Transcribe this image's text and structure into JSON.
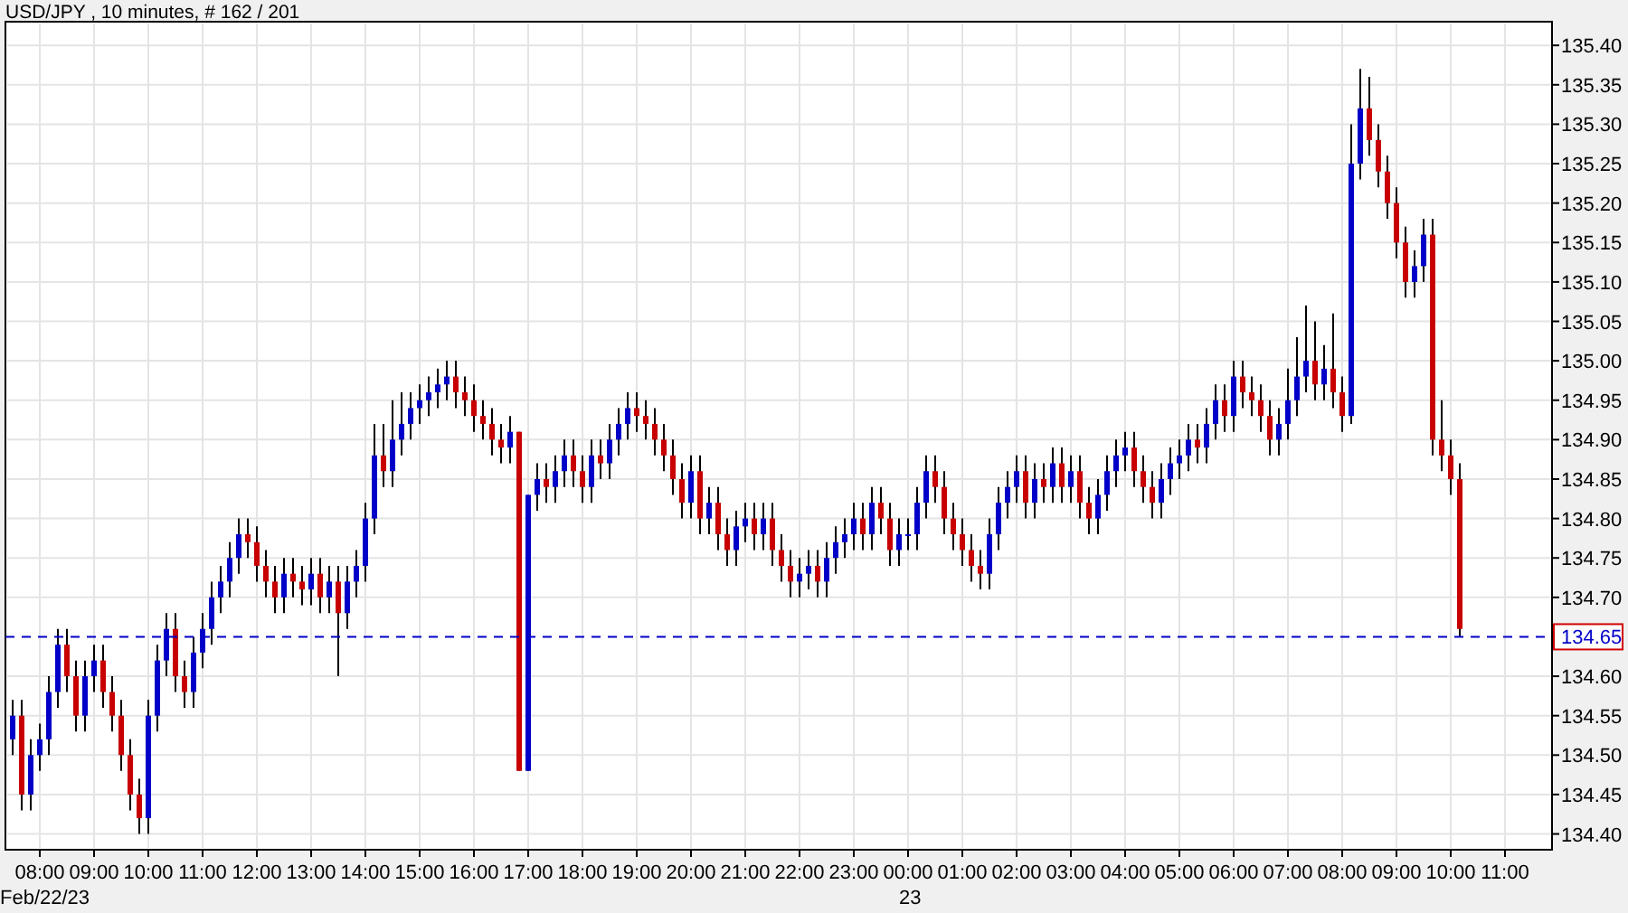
{
  "title": "USD/JPY , 10 minutes, # 162 / 201",
  "date_labels": [
    "Feb/22/23",
    "23"
  ],
  "chart_data": {
    "type": "candlestick",
    "ylim": [
      134.38,
      135.43
    ],
    "grid": true,
    "ref_lines": [
      {
        "axis": "y",
        "value": 134.65,
        "label": "134.65",
        "color": "#0000c8"
      }
    ],
    "yticks": [
      {
        "value": 134.4,
        "label": "134.40"
      },
      {
        "value": 134.45,
        "label": "134.45"
      },
      {
        "value": 134.5,
        "label": "134.50"
      },
      {
        "value": 134.55,
        "label": "134.55"
      },
      {
        "value": 134.6,
        "label": "134.60"
      },
      {
        "value": 134.7,
        "label": "134.70"
      },
      {
        "value": 134.75,
        "label": "134.75"
      },
      {
        "value": 134.8,
        "label": "134.80"
      },
      {
        "value": 134.85,
        "label": "134.85"
      },
      {
        "value": 134.9,
        "label": "134.90"
      },
      {
        "value": 134.95,
        "label": "134.95"
      },
      {
        "value": 135.0,
        "label": "135.00"
      },
      {
        "value": 135.05,
        "label": "135.05"
      },
      {
        "value": 135.1,
        "label": "135.10"
      },
      {
        "value": 135.15,
        "label": "135.15"
      },
      {
        "value": 135.2,
        "label": "135.20"
      },
      {
        "value": 135.25,
        "label": "135.25"
      },
      {
        "value": 135.3,
        "label": "135.30"
      },
      {
        "value": 135.35,
        "label": "135.35"
      },
      {
        "value": 135.4,
        "label": "135.40"
      }
    ],
    "categories": [
      null,
      null,
      null,
      "08:00",
      null,
      null,
      null,
      null,
      null,
      "09:00",
      null,
      null,
      null,
      null,
      null,
      "10:00",
      null,
      null,
      null,
      null,
      null,
      "11:00",
      null,
      null,
      null,
      null,
      null,
      "12:00",
      null,
      null,
      null,
      null,
      null,
      "13:00",
      null,
      null,
      null,
      null,
      null,
      "14:00",
      null,
      null,
      null,
      null,
      null,
      "15:00",
      null,
      null,
      null,
      null,
      null,
      "16:00",
      null,
      null,
      null,
      null,
      null,
      "17:00",
      null,
      null,
      null,
      null,
      null,
      "18:00",
      null,
      null,
      null,
      null,
      null,
      "19:00",
      null,
      null,
      null,
      null,
      null,
      "20:00",
      null,
      null,
      null,
      null,
      null,
      "21:00",
      null,
      null,
      null,
      null,
      null,
      "22:00",
      null,
      null,
      null,
      null,
      null,
      "23:00",
      null,
      null,
      null,
      null,
      null,
      "00:00",
      null,
      null,
      null,
      null,
      null,
      "01:00",
      null,
      null,
      null,
      null,
      null,
      "02:00",
      null,
      null,
      null,
      null,
      null,
      "03:00",
      null,
      null,
      null,
      null,
      null,
      "04:00",
      null,
      null,
      null,
      null,
      null,
      "05:00",
      null,
      null,
      null,
      null,
      null,
      "06:00",
      null,
      null,
      null,
      null,
      null,
      "07:00",
      null,
      null,
      null,
      null,
      null,
      "08:00",
      null,
      null,
      null,
      null,
      null,
      "09:00",
      null,
      null,
      null,
      null,
      null,
      "10:00",
      null,
      null,
      null,
      null,
      null,
      "11:00"
    ],
    "ohlc": [
      [
        134.52,
        134.57,
        134.5,
        134.55
      ],
      [
        134.55,
        134.57,
        134.43,
        134.45
      ],
      [
        134.45,
        134.52,
        134.43,
        134.5
      ],
      [
        134.5,
        134.54,
        134.48,
        134.52
      ],
      [
        134.52,
        134.6,
        134.5,
        134.58
      ],
      [
        134.58,
        134.66,
        134.56,
        134.64
      ],
      [
        134.64,
        134.66,
        134.58,
        134.6
      ],
      [
        134.6,
        134.62,
        134.53,
        134.55
      ],
      [
        134.55,
        134.62,
        134.53,
        134.6
      ],
      [
        134.6,
        134.64,
        134.58,
        134.62
      ],
      [
        134.62,
        134.64,
        134.56,
        134.58
      ],
      [
        134.58,
        134.6,
        134.53,
        134.55
      ],
      [
        134.55,
        134.57,
        134.48,
        134.5
      ],
      [
        134.5,
        134.52,
        134.43,
        134.45
      ],
      [
        134.45,
        134.47,
        134.4,
        134.42
      ],
      [
        134.42,
        134.57,
        134.4,
        134.55
      ],
      [
        134.55,
        134.64,
        134.53,
        134.62
      ],
      [
        134.62,
        134.68,
        134.6,
        134.66
      ],
      [
        134.66,
        134.68,
        134.58,
        134.6
      ],
      [
        134.6,
        134.62,
        134.56,
        134.58
      ],
      [
        134.58,
        134.65,
        134.56,
        134.63
      ],
      [
        134.63,
        134.68,
        134.61,
        134.66
      ],
      [
        134.66,
        134.72,
        134.64,
        134.7
      ],
      [
        134.7,
        134.74,
        134.68,
        134.72
      ],
      [
        134.72,
        134.77,
        134.7,
        134.75
      ],
      [
        134.75,
        134.8,
        134.73,
        134.78
      ],
      [
        134.78,
        134.8,
        134.75,
        134.77
      ],
      [
        134.77,
        134.79,
        134.72,
        134.74
      ],
      [
        134.74,
        134.76,
        134.7,
        134.72
      ],
      [
        134.72,
        134.74,
        134.68,
        134.7
      ],
      [
        134.7,
        134.75,
        134.68,
        134.73
      ],
      [
        134.73,
        134.75,
        134.7,
        134.72
      ],
      [
        134.72,
        134.74,
        134.69,
        134.71
      ],
      [
        134.71,
        134.75,
        134.69,
        134.73
      ],
      [
        134.73,
        134.75,
        134.68,
        134.7
      ],
      [
        134.7,
        134.74,
        134.68,
        134.72
      ],
      [
        134.72,
        134.74,
        134.6,
        134.68
      ],
      [
        134.68,
        134.74,
        134.66,
        134.72
      ],
      [
        134.72,
        134.76,
        134.7,
        134.74
      ],
      [
        134.74,
        134.82,
        134.72,
        134.8
      ],
      [
        134.8,
        134.92,
        134.78,
        134.88
      ],
      [
        134.88,
        134.92,
        134.84,
        134.86
      ],
      [
        134.86,
        134.95,
        134.84,
        134.9
      ],
      [
        134.9,
        134.96,
        134.88,
        134.92
      ],
      [
        134.92,
        134.96,
        134.9,
        134.94
      ],
      [
        134.94,
        134.97,
        134.92,
        134.95
      ],
      [
        134.95,
        134.98,
        134.93,
        134.96
      ],
      [
        134.96,
        134.99,
        134.94,
        134.97
      ],
      [
        134.97,
        135.0,
        134.95,
        134.98
      ],
      [
        134.98,
        135.0,
        134.94,
        134.96
      ],
      [
        134.96,
        134.98,
        134.93,
        134.95
      ],
      [
        134.95,
        134.97,
        134.91,
        134.93
      ],
      [
        134.93,
        134.95,
        134.9,
        134.92
      ],
      [
        134.92,
        134.94,
        134.88,
        134.9
      ],
      [
        134.9,
        134.92,
        134.87,
        134.89
      ],
      [
        134.89,
        134.93,
        134.87,
        134.91
      ],
      [
        134.91,
        134.91,
        134.48,
        134.48
      ],
      [
        134.48,
        134.83,
        134.48,
        134.83
      ],
      [
        134.83,
        134.87,
        134.81,
        134.85
      ],
      [
        134.85,
        134.87,
        134.82,
        134.84
      ],
      [
        134.84,
        134.88,
        134.82,
        134.86
      ],
      [
        134.86,
        134.9,
        134.84,
        134.88
      ],
      [
        134.88,
        134.9,
        134.84,
        134.86
      ],
      [
        134.86,
        134.88,
        134.82,
        134.84
      ],
      [
        134.84,
        134.9,
        134.82,
        134.88
      ],
      [
        134.88,
        134.9,
        134.85,
        134.87
      ],
      [
        134.87,
        134.92,
        134.85,
        134.9
      ],
      [
        134.9,
        134.94,
        134.88,
        134.92
      ],
      [
        134.92,
        134.96,
        134.9,
        134.94
      ],
      [
        134.94,
        134.96,
        134.91,
        134.93
      ],
      [
        134.93,
        134.95,
        134.9,
        134.92
      ],
      [
        134.92,
        134.94,
        134.88,
        134.9
      ],
      [
        134.9,
        134.92,
        134.86,
        134.88
      ],
      [
        134.88,
        134.9,
        134.83,
        134.85
      ],
      [
        134.85,
        134.87,
        134.8,
        134.82
      ],
      [
        134.82,
        134.88,
        134.8,
        134.86
      ],
      [
        134.86,
        134.88,
        134.78,
        134.8
      ],
      [
        134.8,
        134.84,
        134.78,
        134.82
      ],
      [
        134.82,
        134.84,
        134.76,
        134.78
      ],
      [
        134.78,
        134.8,
        134.74,
        134.76
      ],
      [
        134.76,
        134.81,
        134.74,
        134.79
      ],
      [
        134.79,
        134.82,
        134.77,
        134.8
      ],
      [
        134.8,
        134.82,
        134.76,
        134.78
      ],
      [
        134.78,
        134.82,
        134.76,
        134.8
      ],
      [
        134.8,
        134.82,
        134.74,
        134.76
      ],
      [
        134.76,
        134.78,
        134.72,
        134.74
      ],
      [
        134.74,
        134.76,
        134.7,
        134.72
      ],
      [
        134.72,
        134.75,
        134.7,
        134.73
      ],
      [
        134.73,
        134.76,
        134.71,
        134.74
      ],
      [
        134.74,
        134.76,
        134.7,
        134.72
      ],
      [
        134.72,
        134.77,
        134.7,
        134.75
      ],
      [
        134.75,
        134.79,
        134.73,
        134.77
      ],
      [
        134.77,
        134.8,
        134.75,
        134.78
      ],
      [
        134.78,
        134.82,
        134.76,
        134.8
      ],
      [
        134.8,
        134.82,
        134.76,
        134.78
      ],
      [
        134.78,
        134.84,
        134.76,
        134.82
      ],
      [
        134.82,
        134.84,
        134.78,
        134.8
      ],
      [
        134.8,
        134.82,
        134.74,
        134.76
      ],
      [
        134.76,
        134.8,
        134.74,
        134.78
      ],
      [
        134.78,
        134.8,
        134.76,
        134.78
      ],
      [
        134.78,
        134.84,
        134.76,
        134.82
      ],
      [
        134.82,
        134.88,
        134.8,
        134.86
      ],
      [
        134.86,
        134.88,
        134.82,
        134.84
      ],
      [
        134.84,
        134.86,
        134.78,
        134.8
      ],
      [
        134.8,
        134.82,
        134.76,
        134.78
      ],
      [
        134.78,
        134.8,
        134.74,
        134.76
      ],
      [
        134.76,
        134.78,
        134.72,
        134.74
      ],
      [
        134.74,
        134.76,
        134.71,
        134.73
      ],
      [
        134.73,
        134.8,
        134.71,
        134.78
      ],
      [
        134.78,
        134.84,
        134.76,
        134.82
      ],
      [
        134.82,
        134.86,
        134.8,
        134.84
      ],
      [
        134.84,
        134.88,
        134.82,
        134.86
      ],
      [
        134.86,
        134.88,
        134.8,
        134.82
      ],
      [
        134.82,
        134.87,
        134.8,
        134.85
      ],
      [
        134.85,
        134.87,
        134.82,
        134.84
      ],
      [
        134.84,
        134.89,
        134.82,
        134.87
      ],
      [
        134.87,
        134.89,
        134.82,
        134.84
      ],
      [
        134.84,
        134.88,
        134.82,
        134.86
      ],
      [
        134.86,
        134.88,
        134.8,
        134.82
      ],
      [
        134.82,
        134.84,
        134.78,
        134.8
      ],
      [
        134.8,
        134.85,
        134.78,
        134.83
      ],
      [
        134.83,
        134.88,
        134.81,
        134.86
      ],
      [
        134.86,
        134.9,
        134.84,
        134.88
      ],
      [
        134.88,
        134.91,
        134.86,
        134.89
      ],
      [
        134.89,
        134.91,
        134.84,
        134.86
      ],
      [
        134.86,
        134.88,
        134.82,
        134.84
      ],
      [
        134.84,
        134.86,
        134.8,
        134.82
      ],
      [
        134.82,
        134.87,
        134.8,
        134.85
      ],
      [
        134.85,
        134.89,
        134.83,
        134.87
      ],
      [
        134.87,
        134.9,
        134.85,
        134.88
      ],
      [
        134.88,
        134.92,
        134.86,
        134.9
      ],
      [
        134.9,
        134.92,
        134.87,
        134.89
      ],
      [
        134.89,
        134.94,
        134.87,
        134.92
      ],
      [
        134.92,
        134.97,
        134.9,
        134.95
      ],
      [
        134.95,
        134.97,
        134.91,
        134.93
      ],
      [
        134.93,
        135.0,
        134.91,
        134.98
      ],
      [
        134.98,
        135.0,
        134.94,
        134.96
      ],
      [
        134.96,
        134.98,
        134.93,
        134.95
      ],
      [
        134.95,
        134.97,
        134.91,
        134.93
      ],
      [
        134.93,
        134.95,
        134.88,
        134.9
      ],
      [
        134.9,
        134.94,
        134.88,
        134.92
      ],
      [
        134.92,
        134.99,
        134.9,
        134.95
      ],
      [
        134.95,
        135.03,
        134.93,
        134.98
      ],
      [
        134.98,
        135.07,
        134.96,
        135.0
      ],
      [
        135.0,
        135.05,
        134.95,
        134.97
      ],
      [
        134.97,
        135.02,
        134.95,
        134.99
      ],
      [
        134.99,
        135.06,
        134.94,
        134.96
      ],
      [
        134.96,
        134.98,
        134.91,
        134.93
      ],
      [
        134.93,
        135.3,
        134.92,
        135.25
      ],
      [
        135.25,
        135.37,
        135.23,
        135.32
      ],
      [
        135.32,
        135.36,
        135.26,
        135.28
      ],
      [
        135.28,
        135.3,
        135.22,
        135.24
      ],
      [
        135.24,
        135.26,
        135.18,
        135.2
      ],
      [
        135.2,
        135.22,
        135.13,
        135.15
      ],
      [
        135.15,
        135.17,
        135.08,
        135.1
      ],
      [
        135.1,
        135.14,
        135.08,
        135.12
      ],
      [
        135.12,
        135.18,
        135.1,
        135.16
      ],
      [
        135.16,
        135.18,
        134.88,
        134.9
      ],
      [
        134.9,
        134.95,
        134.86,
        134.88
      ],
      [
        134.88,
        134.9,
        134.83,
        134.85
      ],
      [
        134.85,
        134.87,
        134.65,
        134.66
      ],
      null,
      null,
      null,
      null,
      null
    ]
  }
}
